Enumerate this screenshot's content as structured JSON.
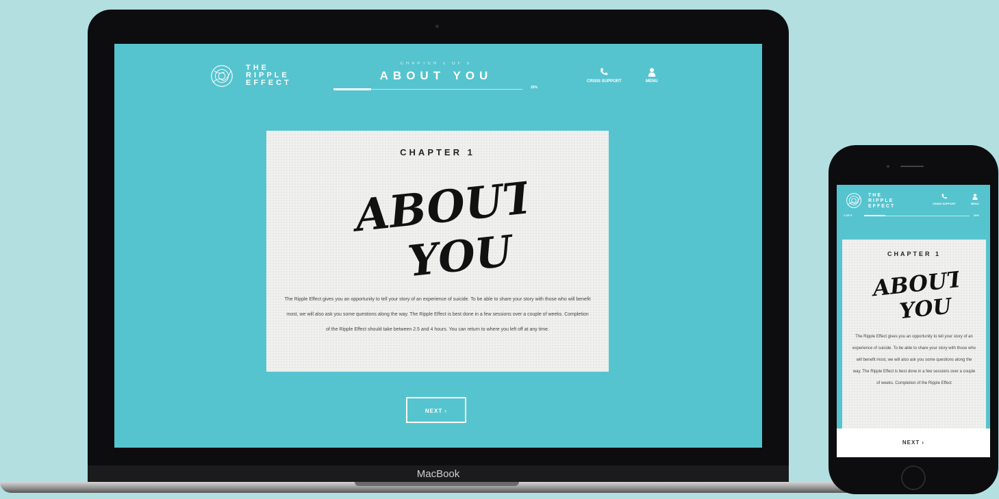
{
  "brand": {
    "lines": [
      "THE",
      "RIPPLE",
      "EFFECT"
    ]
  },
  "header": {
    "chapter_small": "CHAPTER 1 OF 5",
    "chapter_title": "ABOUT YOU",
    "progress_percent": 20,
    "progress_label": "20%",
    "crisis_label": "CRISIS SUPPORT",
    "menu_label": "MENU"
  },
  "card": {
    "chapter": "CHAPTER 1",
    "script_line1": "ABOUT",
    "script_line2": "YOU",
    "body": "The Ripple Effect gives you an opportunity to tell your story of an experience of suicide. To be able to share your story with those who will benefit most, we will also ask you some questions along the way. The Ripple Effect is best done in a few sessions over a couple of weeks. Completion of the Ripple Effect should take between 2.5 and 4 hours. You can return to where you left off at any time."
  },
  "next_button": "NEXT ›",
  "laptop_brand": "MacBook",
  "phone": {
    "chapter_small": "1 OF 5",
    "progress_label": "20%",
    "crisis_label": "CRISIS SUPPORT",
    "menu_label": "MENU",
    "body": "The Ripple Effect gives you an opportunity to tell your story of an experience of suicide. To be able to share your story with those who will benefit most, we will also ask you some questions along the way. The Ripple Effect is best done in a few sessions over a couple of weeks. Completion of the Ripple Effect",
    "next_button": "NEXT ›"
  },
  "colors": {
    "background": "#b3dfe1",
    "screen": "#55c4cf",
    "card": "#f0f0ef"
  }
}
